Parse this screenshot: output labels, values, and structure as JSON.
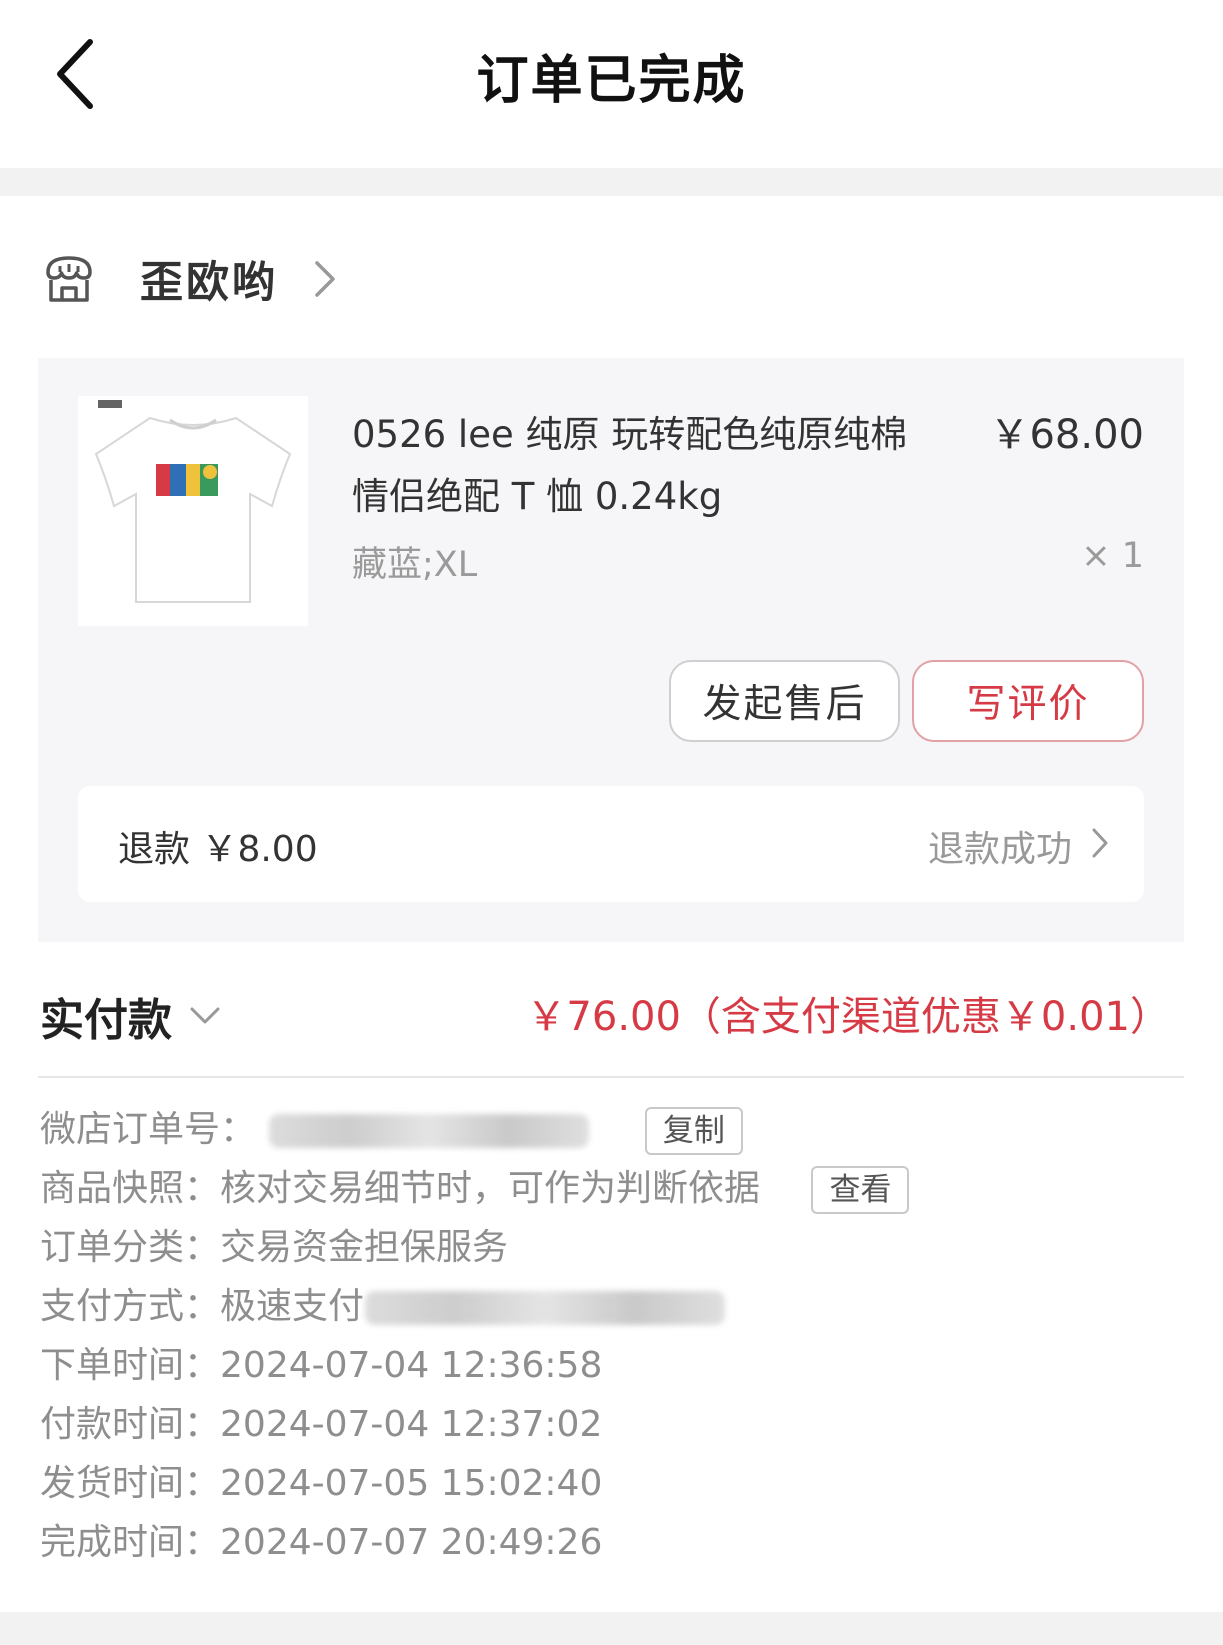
{
  "header": {
    "title": "订单已完成"
  },
  "shop": {
    "name": "歪欧哟"
  },
  "product": {
    "title": "0526 lee 纯原 玩转配色纯原纯棉情侣绝配 T 恤  0.24kg",
    "price": "￥68.00",
    "variant": "藏蓝;XL",
    "quantity": "× 1"
  },
  "actions": {
    "after_sale": "发起售后",
    "review": "写评价"
  },
  "refund": {
    "label": "退款 ￥8.00",
    "status": "退款成功"
  },
  "payment": {
    "label": "实付款",
    "amount": "￥76.00（含支付渠道优惠￥0.01）"
  },
  "order_info": {
    "order_no_label": "微店订单号：",
    "copy_label": "复制",
    "snapshot_label": "商品快照：",
    "snapshot_value": "核对交易细节时，可作为判断依据",
    "view_label": "查看",
    "category_label": "订单分类：",
    "category_value": "交易资金担保服务",
    "pay_method_label": "支付方式：",
    "pay_method_value": "极速支付",
    "times": [
      {
        "label": "下单时间：",
        "value": "2024-07-04 12:36:58"
      },
      {
        "label": "付款时间：",
        "value": "2024-07-04 12:37:02"
      },
      {
        "label": "发货时间：",
        "value": "2024-07-05 15:02:40"
      },
      {
        "label": "完成时间：",
        "value": "2024-07-07 20:49:26"
      }
    ]
  },
  "colors": {
    "accent": "#d63a45",
    "muted": "#8e8e8e",
    "card_bg": "#f6f6f8"
  },
  "icons": [
    "back-arrow-icon",
    "shop-icon",
    "chevron-right-icon",
    "chevron-down-icon"
  ]
}
